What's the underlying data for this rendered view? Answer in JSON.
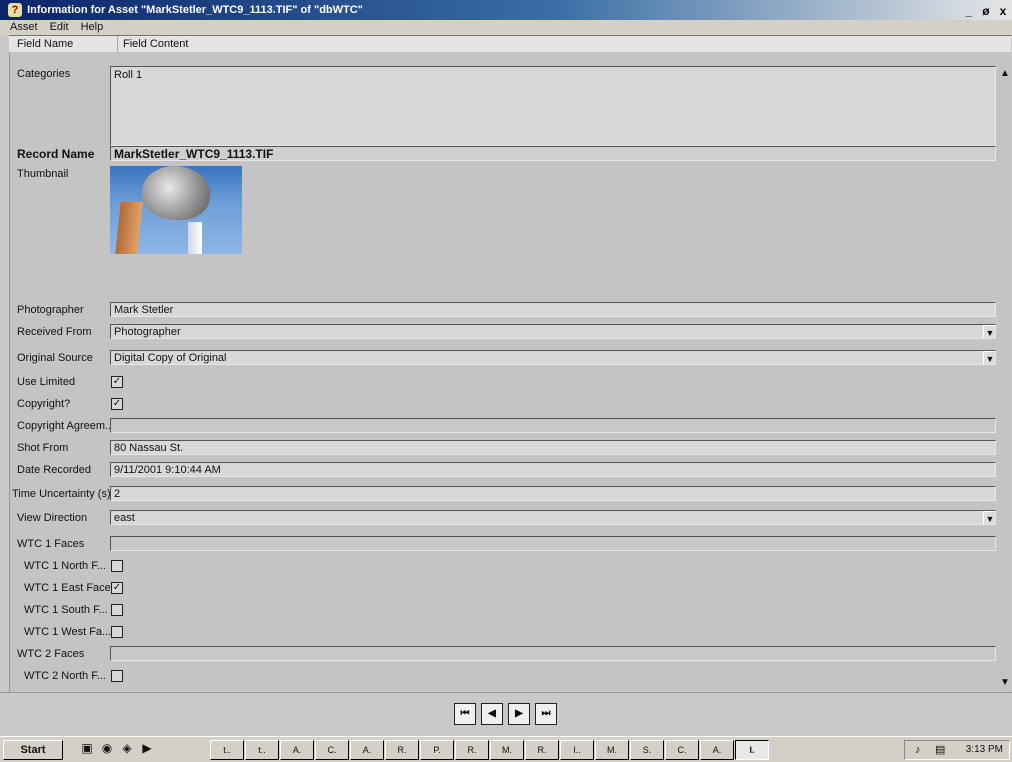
{
  "window": {
    "title": "Information for Asset \"MarkStetler_WTC9_1113.TIF\" of \"dbWTC\"",
    "controls": [
      "_",
      "ø",
      "x"
    ]
  },
  "menu": [
    "Asset",
    "Edit",
    "Help"
  ],
  "table_headers": {
    "name": "Field Name",
    "content": "Field Content"
  },
  "fields": {
    "categories": {
      "label": "Categories",
      "value": "Roll 1"
    },
    "record_name": {
      "label": "Record Name",
      "value": "MarkStetler_WTC9_1113.TIF"
    },
    "thumbnail": {
      "label": "Thumbnail"
    },
    "photographer": {
      "label": "Photographer",
      "value": "Mark Stetler"
    },
    "received_from": {
      "label": "Received From",
      "value": "Photographer"
    },
    "original_source": {
      "label": "Original Source",
      "value": "Digital Copy of Original"
    },
    "use_limited": {
      "label": "Use Limited",
      "checked": true
    },
    "copyright": {
      "label": "Copyright?",
      "checked": true
    },
    "copyright_agreement": {
      "label": "Copyright Agreem...",
      "value": ""
    },
    "shot_from": {
      "label": "Shot From",
      "value": "80 Nassau St."
    },
    "date_recorded": {
      "label": "Date Recorded",
      "value": "9/11/2001 9:10:44 AM"
    },
    "time_uncertainty": {
      "label": "Time Uncertainty (s)",
      "value": "2"
    },
    "view_direction": {
      "label": "View Direction",
      "value": "east"
    },
    "wtc1_faces": {
      "label": "WTC 1 Faces",
      "value": ""
    },
    "wtc1_north": {
      "label": "WTC 1 North F...",
      "checked": false
    },
    "wtc1_east": {
      "label": "WTC 1 East Face",
      "checked": true
    },
    "wtc1_south": {
      "label": "WTC 1 South F...",
      "checked": false
    },
    "wtc1_west": {
      "label": "WTC 1 West Fa...",
      "checked": false
    },
    "wtc2_faces": {
      "label": "WTC 2 Faces",
      "value": ""
    },
    "wtc2_north": {
      "label": "WTC 2 North F...",
      "checked": false
    }
  },
  "nav_buttons": [
    "⏮",
    "◀",
    "▶",
    "⏭"
  ],
  "taskbar": {
    "start": "Start",
    "tasks": [
      "t..",
      "t..",
      "A.",
      "C.",
      "A.",
      "R.",
      "P.",
      "R.",
      "M.",
      "R.",
      "I..",
      "M.",
      "S.",
      "C.",
      "A.",
      "I."
    ],
    "clock": "3:13 PM"
  }
}
